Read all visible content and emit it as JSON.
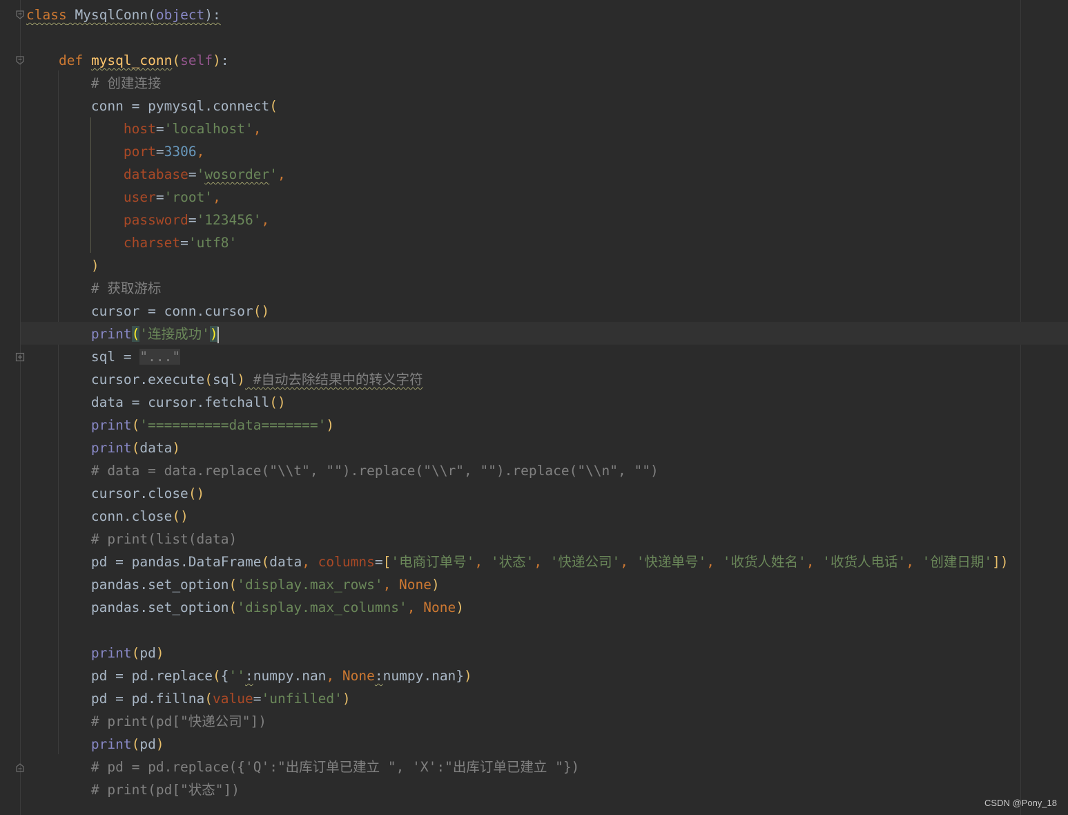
{
  "colors": {
    "background": "#2b2b2b",
    "keyword": "#cc7832",
    "function_name": "#ffc66d",
    "self": "#94558d",
    "builtin": "#8888c6",
    "comment": "#808080",
    "string": "#6a8759",
    "number": "#6897bb",
    "parameter": "#aa4926",
    "plain": "#a9b7c6",
    "bracket": "#e8bf6a"
  },
  "editor": {
    "current_line": 14,
    "lines": [
      [
        [
          "t-kw wavy",
          "class"
        ],
        [
          "t-pl wavy",
          " MysqlConn("
        ],
        [
          "t-builtin wavy",
          "object"
        ],
        [
          "t-pl wavy",
          "):"
        ]
      ],
      [],
      [
        [
          "t-pl",
          "    "
        ],
        [
          "t-kw",
          "def "
        ],
        [
          "t-def wavy",
          "mysql_conn"
        ],
        [
          "t-brace",
          "("
        ],
        [
          "t-self",
          "self"
        ],
        [
          "t-brace",
          ")"
        ],
        [
          "t-pl",
          ":"
        ]
      ],
      [
        [
          "t-cmt",
          "        # 创建连接"
        ]
      ],
      [
        [
          "t-pl",
          "        conn = pymysql.connect"
        ],
        [
          "t-brace",
          "("
        ]
      ],
      [
        [
          "t-pl",
          "            "
        ],
        [
          "t-param",
          "host"
        ],
        [
          "t-pl",
          "="
        ],
        [
          "t-str",
          "'localhost'"
        ],
        [
          "t-kw",
          ","
        ]
      ],
      [
        [
          "t-pl",
          "            "
        ],
        [
          "t-param",
          "port"
        ],
        [
          "t-pl",
          "="
        ],
        [
          "t-num",
          "3306"
        ],
        [
          "t-kw",
          ","
        ]
      ],
      [
        [
          "t-pl",
          "            "
        ],
        [
          "t-param",
          "database"
        ],
        [
          "t-pl",
          "="
        ],
        [
          "t-str",
          "'"
        ],
        [
          "t-str wavy",
          "wosorder"
        ],
        [
          "t-str",
          "'"
        ],
        [
          "t-kw",
          ","
        ]
      ],
      [
        [
          "t-pl",
          "            "
        ],
        [
          "t-param",
          "user"
        ],
        [
          "t-pl",
          "="
        ],
        [
          "t-str",
          "'root'"
        ],
        [
          "t-kw",
          ","
        ]
      ],
      [
        [
          "t-pl",
          "            "
        ],
        [
          "t-param",
          "password"
        ],
        [
          "t-pl",
          "="
        ],
        [
          "t-str",
          "'123456'"
        ],
        [
          "t-kw",
          ","
        ]
      ],
      [
        [
          "t-pl",
          "            "
        ],
        [
          "t-param",
          "charset"
        ],
        [
          "t-pl",
          "="
        ],
        [
          "t-str",
          "'utf8'"
        ]
      ],
      [
        [
          "t-pl",
          "        "
        ],
        [
          "t-brace",
          ")"
        ]
      ],
      [
        [
          "t-cmt",
          "        # 获取游标"
        ]
      ],
      [
        [
          "t-pl",
          "        cursor = conn.cursor"
        ],
        [
          "t-brace",
          "()"
        ]
      ],
      [
        [
          "t-pl",
          "        "
        ],
        [
          "t-builtin",
          "print"
        ],
        [
          "t-hl",
          "("
        ],
        [
          "t-str",
          "'连接成功'"
        ],
        [
          "t-hl",
          ")"
        ]
      ],
      [
        [
          "t-pl",
          "        sql = "
        ],
        [
          "t-fold",
          "\"...\""
        ]
      ],
      [
        [
          "t-pl",
          "        cursor.execute"
        ],
        [
          "t-brace",
          "("
        ],
        [
          "t-pl",
          "sql"
        ],
        [
          "t-brace",
          ")"
        ],
        [
          "t-cmt wavy",
          " #自动去除结果中的转义字符"
        ]
      ],
      [
        [
          "t-pl",
          "        data = cursor.fetchall"
        ],
        [
          "t-brace",
          "()"
        ]
      ],
      [
        [
          "t-pl",
          "        "
        ],
        [
          "t-builtin",
          "print"
        ],
        [
          "t-brace",
          "("
        ],
        [
          "t-str",
          "'==========data======='"
        ],
        [
          "t-brace",
          ")"
        ]
      ],
      [
        [
          "t-pl",
          "        "
        ],
        [
          "t-builtin",
          "print"
        ],
        [
          "t-brace",
          "("
        ],
        [
          "t-pl",
          "data"
        ],
        [
          "t-brace",
          ")"
        ]
      ],
      [
        [
          "t-cmt",
          "        # data = data.replace(\"\\\\t\", \"\").replace(\"\\\\r\", \"\").replace(\"\\\\n\", \"\")"
        ]
      ],
      [
        [
          "t-pl",
          "        cursor.close"
        ],
        [
          "t-brace",
          "()"
        ]
      ],
      [
        [
          "t-pl",
          "        conn.close"
        ],
        [
          "t-brace",
          "()"
        ]
      ],
      [
        [
          "t-cmt",
          "        # print(list(data)"
        ]
      ],
      [
        [
          "t-pl",
          "        pd = pandas.DataFrame"
        ],
        [
          "t-brace",
          "("
        ],
        [
          "t-pl",
          "data"
        ],
        [
          "t-kw",
          ", "
        ],
        [
          "t-param",
          "columns"
        ],
        [
          "t-pl",
          "="
        ],
        [
          "t-brace",
          "["
        ],
        [
          "t-str",
          "'电商订单号'"
        ],
        [
          "t-kw",
          ", "
        ],
        [
          "t-str",
          "'状态'"
        ],
        [
          "t-kw",
          ", "
        ],
        [
          "t-str",
          "'快递公司'"
        ],
        [
          "t-kw",
          ", "
        ],
        [
          "t-str",
          "'快递单号'"
        ],
        [
          "t-kw",
          ", "
        ],
        [
          "t-str",
          "'收货人姓名'"
        ],
        [
          "t-kw",
          ", "
        ],
        [
          "t-str",
          "'收货人电话'"
        ],
        [
          "t-kw",
          ", "
        ],
        [
          "t-str",
          "'创建日期'"
        ],
        [
          "t-brace",
          "])"
        ]
      ],
      [
        [
          "t-pl",
          "        pandas.set_option"
        ],
        [
          "t-brace",
          "("
        ],
        [
          "t-str",
          "'display.max_rows'"
        ],
        [
          "t-kw",
          ", None"
        ],
        [
          "t-brace",
          ")"
        ]
      ],
      [
        [
          "t-pl",
          "        pandas.set_option"
        ],
        [
          "t-brace",
          "("
        ],
        [
          "t-str",
          "'display.max_columns'"
        ],
        [
          "t-kw",
          ", None"
        ],
        [
          "t-brace",
          ")"
        ]
      ],
      [],
      [
        [
          "t-pl",
          "        "
        ],
        [
          "t-builtin",
          "print"
        ],
        [
          "t-brace",
          "("
        ],
        [
          "t-pl",
          "pd"
        ],
        [
          "t-brace",
          ")"
        ]
      ],
      [
        [
          "t-pl",
          "        pd = pd.replace"
        ],
        [
          "t-brace",
          "("
        ],
        [
          "t-pl",
          "{"
        ],
        [
          "t-str",
          "''"
        ],
        [
          "t-pl wavy",
          ":"
        ],
        [
          "t-pl",
          "numpy.nan"
        ],
        [
          "t-kw",
          ", None"
        ],
        [
          "t-pl wavy",
          ":"
        ],
        [
          "t-pl",
          "numpy.nan}"
        ],
        [
          "t-brace",
          ")"
        ]
      ],
      [
        [
          "t-pl",
          "        pd = pd.fillna"
        ],
        [
          "t-brace",
          "("
        ],
        [
          "t-param",
          "value"
        ],
        [
          "t-pl",
          "="
        ],
        [
          "t-str",
          "'unfilled'"
        ],
        [
          "t-brace",
          ")"
        ]
      ],
      [
        [
          "t-cmt",
          "        # print(pd[\"快递公司\"])"
        ]
      ],
      [
        [
          "t-pl",
          "        "
        ],
        [
          "t-builtin",
          "print"
        ],
        [
          "t-brace",
          "("
        ],
        [
          "t-pl",
          "pd"
        ],
        [
          "t-brace",
          ")"
        ]
      ],
      [
        [
          "t-cmt",
          "        # pd = pd.replace({'Q':\"出库订单已建立 \", 'X':\"出库订单已建立 \"})"
        ]
      ],
      [
        [
          "t-cmt",
          "        # print(pd[\"状态\"])"
        ]
      ]
    ]
  },
  "watermark": "CSDN @Pony_18"
}
